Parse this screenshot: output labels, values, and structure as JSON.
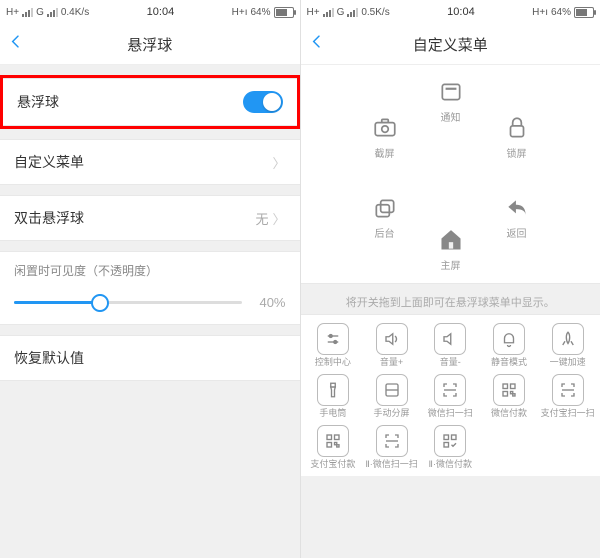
{
  "status": {
    "net": "H+",
    "carrier": "G",
    "signal": "ıı.ıl",
    "speed1": "0.4K/s",
    "speed2": "0.5K/s",
    "time": "10:04",
    "battpct": "64%",
    "hplus": "H+ı"
  },
  "left": {
    "title": "悬浮球",
    "toggle_label": "悬浮球",
    "menu_label": "自定义菜单",
    "dbl_label": "双击悬浮球",
    "dbl_value": "无",
    "slider_title": "闲置时可见度（不透明度）",
    "slider_value": "40%",
    "restore": "恢复默认值"
  },
  "right": {
    "title": "自定义菜单",
    "radial": [
      {
        "key": "notify",
        "label": "通知"
      },
      {
        "key": "screenshot",
        "label": "截屏"
      },
      {
        "key": "lock",
        "label": "锁屏"
      },
      {
        "key": "recents",
        "label": "后台"
      },
      {
        "key": "back",
        "label": "返回"
      },
      {
        "key": "home",
        "label": "主屏"
      }
    ],
    "hint": "将开关拖到上面即可在悬浮球菜单中显示。",
    "grid": [
      {
        "label": "控制中心"
      },
      {
        "label": "音量+"
      },
      {
        "label": "音量-"
      },
      {
        "label": "静音模式"
      },
      {
        "label": "一键加速"
      },
      {
        "label": "手电筒"
      },
      {
        "label": "手动分屏"
      },
      {
        "label": "微信扫一扫"
      },
      {
        "label": "微信付款"
      },
      {
        "label": "支付宝扫一扫"
      },
      {
        "label": "支付宝付款"
      },
      {
        "label": "Ⅱ·微信扫一扫"
      },
      {
        "label": "Ⅱ·微信付款"
      }
    ]
  }
}
